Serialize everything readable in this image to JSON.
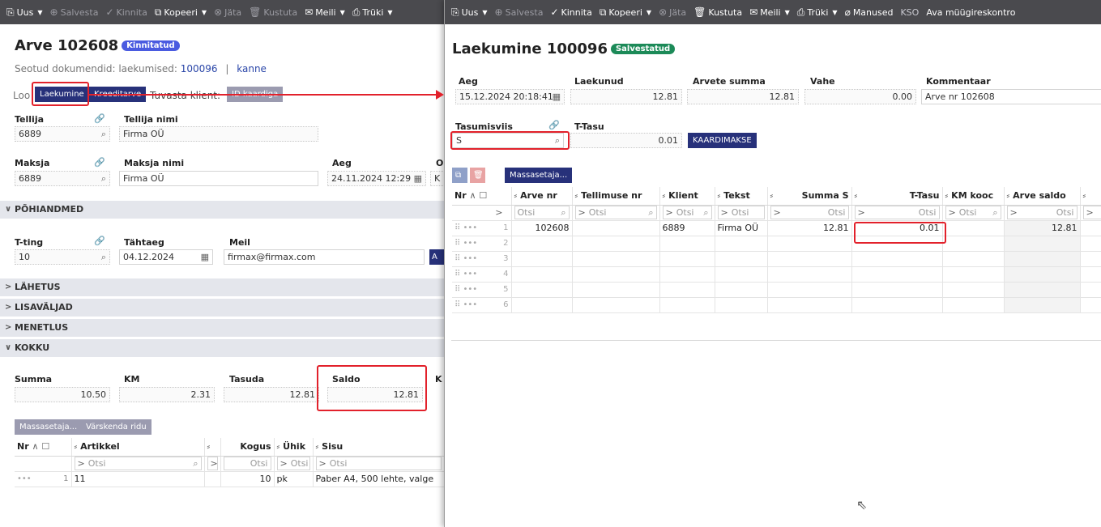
{
  "left": {
    "toolbar": {
      "new": "Uus",
      "save": "Salvesta",
      "confirm": "Kinnita",
      "copy": "Kopeeri",
      "cancel": "Jäta",
      "delete": "Kustuta",
      "mail": "Meili",
      "print": "Trüki"
    },
    "title": "Arve 102608",
    "status": "Kinnitatud",
    "linked_label": "Seotud dokumendid: laekumised:",
    "linked_payment": "100096",
    "linked_sep": "|",
    "linked_entry": "kanne",
    "create_label": "Loo",
    "btn_payment": "Laekumine",
    "btn_credit": "Kreeditarve",
    "replace_client": "Tuvasta klient:",
    "id_btn": "ID kaardiga",
    "tellija": {
      "label": "Tellija",
      "value": "6889"
    },
    "tellija_nimi": {
      "label": "Tellija nimi",
      "value": "Firma OÜ"
    },
    "maksja": {
      "label": "Maksja",
      "value": "6889"
    },
    "maksja_nimi": {
      "label": "Maksja nimi",
      "value": "Firma OÜ"
    },
    "aeg": {
      "label": "Aeg",
      "value": "24.11.2024 12:29"
    },
    "other_label": "O",
    "other_value": "K",
    "section_main": "PÕHIANDMED",
    "tting": {
      "label": "T-ting",
      "value": "10"
    },
    "tahtaeg": {
      "label": "Tähtaeg",
      "value": "04.12.2024"
    },
    "meil": {
      "label": "Meil",
      "value": "firmax@firmax.com"
    },
    "meil_btn": "A",
    "sections": [
      "LÄHETUS",
      "LISAVÄLJAD",
      "MENETLUS"
    ],
    "section_total": "KOKKU",
    "totals": {
      "summa": {
        "label": "Summa",
        "value": "10.50"
      },
      "km": {
        "label": "KM",
        "value": "2.31"
      },
      "tasuda": {
        "label": "Tasuda",
        "value": "12.81"
      },
      "saldo": {
        "label": "Saldo",
        "value": "12.81"
      },
      "extra": "K"
    },
    "btn_mass": "Massasetaja...",
    "btn_refresh": "Värskenda ridu",
    "grid": {
      "headers": [
        "Nr",
        "Artikkel",
        "",
        "Kogus",
        "Ühik",
        "Sisu"
      ],
      "filter": "Otsi",
      "row": {
        "nr": "1",
        "artikkel": "11",
        "kogus": "10",
        "uhik": "pk",
        "sisu": "Paber A4, 500 lehte, valge"
      }
    }
  },
  "right": {
    "toolbar": {
      "new": "Uus",
      "save": "Salvesta",
      "confirm": "Kinnita",
      "copy": "Kopeeri",
      "cancel": "Jäta",
      "delete": "Kustuta",
      "mail": "Meili",
      "print": "Trüki",
      "attachments": "Manused",
      "kso": "KSO",
      "open_ledger": "Ava müügireskontro"
    },
    "title": "Laekumine 100096",
    "status": "Salvestatud",
    "aeg": {
      "label": "Aeg",
      "value": "15.12.2024 20:18:41"
    },
    "laekunud": {
      "label": "Laekunud",
      "value": "12.81"
    },
    "arvete_summa": {
      "label": "Arvete summa",
      "value": "12.81"
    },
    "vahe": {
      "label": "Vahe",
      "value": "0.00"
    },
    "kommentaar": {
      "label": "Kommentaar",
      "value": "Arve nr 102608"
    },
    "tasumisviis": {
      "label": "Tasumisviis",
      "value": "S"
    },
    "ttasu": {
      "label": "T-Tasu",
      "value": "0.01"
    },
    "card_btn": "KAARDIMAKSE",
    "btn_mass": "Massasetaja...",
    "grid": {
      "headers": [
        "Nr",
        "Arve nr",
        "Tellimuse nr",
        "Klient",
        "Tekst",
        "Summa S",
        "T-Tasu",
        "KM kooc",
        "Arve saldo"
      ],
      "filter": "Otsi",
      "row": {
        "nr": "1",
        "arve_nr": "102608",
        "klient": "6889",
        "tekst": "Firma OÜ",
        "summa": "12.81",
        "ttasu": "0.01",
        "saldo": "12.81"
      },
      "row_numbers": [
        "2",
        "3",
        "4",
        "5",
        "6"
      ],
      "row_handle": "⠿ •••"
    }
  }
}
